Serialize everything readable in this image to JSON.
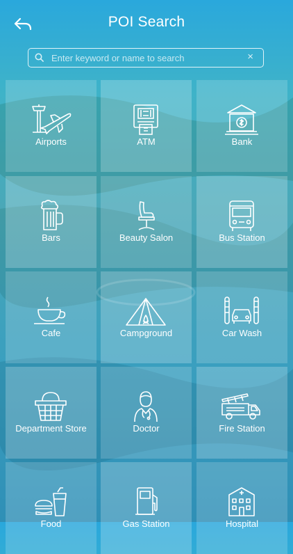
{
  "header": {
    "title": "POI Search",
    "back_icon": "back-arrow-icon"
  },
  "search": {
    "placeholder": "Enter keyword or name to search",
    "value": "",
    "clear_label": "×"
  },
  "categories": [
    {
      "label": "Airports",
      "icon": "airport-icon"
    },
    {
      "label": "ATM",
      "icon": "atm-icon"
    },
    {
      "label": "Bank",
      "icon": "bank-icon"
    },
    {
      "label": "Bars",
      "icon": "beer-icon"
    },
    {
      "label": "Beauty Salon",
      "icon": "salon-chair-icon"
    },
    {
      "label": "Bus Station",
      "icon": "bus-icon"
    },
    {
      "label": "Cafe",
      "icon": "coffee-cup-icon"
    },
    {
      "label": "Campground",
      "icon": "tent-icon"
    },
    {
      "label": "Car Wash",
      "icon": "car-wash-icon"
    },
    {
      "label": "Department Store",
      "icon": "shopping-basket-icon"
    },
    {
      "label": "Doctor",
      "icon": "doctor-icon"
    },
    {
      "label": "Fire Station",
      "icon": "fire-truck-icon"
    },
    {
      "label": "Food",
      "icon": "fast-food-icon"
    },
    {
      "label": "Gas Station",
      "icon": "gas-pump-icon"
    },
    {
      "label": "Hospital",
      "icon": "hospital-icon"
    }
  ]
}
